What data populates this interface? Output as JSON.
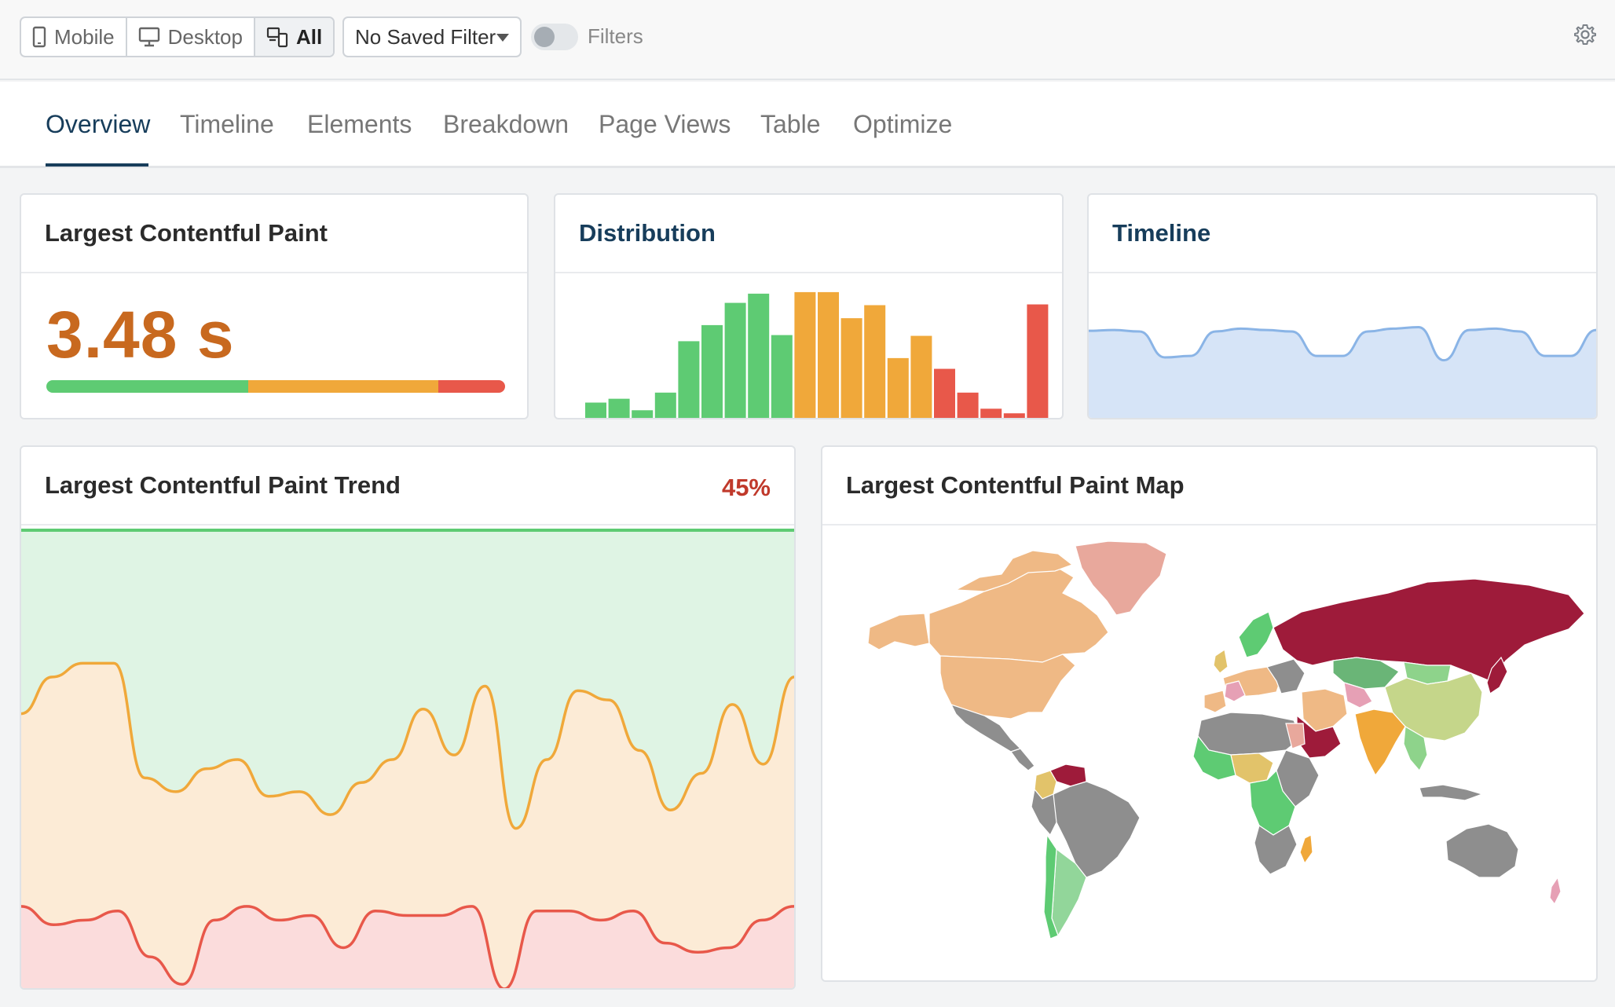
{
  "toolbar": {
    "device_buttons": [
      {
        "label": "Mobile",
        "icon": "mobile-icon",
        "active": false
      },
      {
        "label": "Desktop",
        "icon": "desktop-icon",
        "active": false
      },
      {
        "label": "All",
        "icon": "devices-icon",
        "active": true
      }
    ],
    "saved_filter": "No Saved Filter",
    "filters_label": "Filters",
    "filters_enabled": false,
    "settings_icon": "gear-icon"
  },
  "tabs": [
    {
      "label": "Overview",
      "active": true
    },
    {
      "label": "Timeline",
      "active": false
    },
    {
      "label": "Elements",
      "active": false
    },
    {
      "label": "Breakdown",
      "active": false
    },
    {
      "label": "Page Views",
      "active": false
    },
    {
      "label": "Table",
      "active": false
    },
    {
      "label": "Optimize",
      "active": false
    }
  ],
  "metric_card": {
    "title": "Largest Contentful Paint",
    "value": "3.48 s",
    "distribution": {
      "good": 0.44,
      "needs_improvement": 0.415,
      "poor": 0.145
    }
  },
  "distribution_card": {
    "title": "Distribution"
  },
  "timeline_card": {
    "title": "Timeline"
  },
  "trend_card": {
    "title": "Largest Contentful Paint Trend",
    "percent": "45%"
  },
  "map_card": {
    "title": "Largest Contentful Paint Map"
  },
  "colors": {
    "good": "#5ecb73",
    "needs_improvement": "#f0a83a",
    "poor": "#e8584a",
    "brand": "#173d5b",
    "value_orange": "#c8691f"
  },
  "chart_data": [
    {
      "type": "bar",
      "title": "Distribution",
      "values": [
        22,
        27,
        12,
        35,
        102,
        123,
        152,
        164,
        110,
        166,
        166,
        132,
        149,
        80,
        109,
        66,
        35,
        14,
        8,
        150
      ],
      "bucket_ratings": [
        "good",
        "good",
        "good",
        "good",
        "good",
        "good",
        "good",
        "good",
        "good",
        "needs_improvement",
        "needs_improvement",
        "needs_improvement",
        "needs_improvement",
        "needs_improvement",
        "needs_improvement",
        "poor",
        "poor",
        "poor",
        "poor",
        "poor"
      ],
      "ylim": [
        0,
        170
      ]
    },
    {
      "type": "area",
      "title": "Timeline",
      "values": [
        0.97,
        0.98,
        0.96,
        0.6,
        0.62,
        0.96,
        1.0,
        0.98,
        0.96,
        0.62,
        0.62,
        0.96,
        1.0,
        1.02,
        0.56,
        0.98,
        1.0,
        0.96,
        0.62,
        0.62,
        0.98
      ],
      "ylim": [
        0,
        1.2
      ]
    },
    {
      "type": "area",
      "title": "Largest Contentful Paint Trend",
      "series": [
        {
          "rating": "good",
          "values": [
            1,
            1,
            1,
            1,
            1,
            1,
            1,
            1,
            1,
            1,
            1,
            1,
            1,
            1,
            1,
            1,
            1,
            1,
            1,
            1,
            1,
            1,
            1,
            1,
            1
          ]
        },
        {
          "rating": "needs_improvement",
          "values": [
            0.6,
            0.68,
            0.71,
            0.71,
            0.46,
            0.43,
            0.48,
            0.5,
            0.42,
            0.43,
            0.38,
            0.45,
            0.5,
            0.61,
            0.51,
            0.66,
            0.35,
            0.5,
            0.65,
            0.63,
            0.52,
            0.39,
            0.47,
            0.62,
            0.49,
            0.68
          ]
        },
        {
          "rating": "poor",
          "values": [
            0.18,
            0.14,
            0.15,
            0.17,
            0.07,
            0.01,
            0.15,
            0.18,
            0.15,
            0.16,
            0.09,
            0.17,
            0.16,
            0.16,
            0.18,
            0.0,
            0.17,
            0.17,
            0.15,
            0.17,
            0.1,
            0.08,
            0.09,
            0.15,
            0.18
          ]
        }
      ],
      "ylim": [
        0,
        1
      ]
    }
  ]
}
